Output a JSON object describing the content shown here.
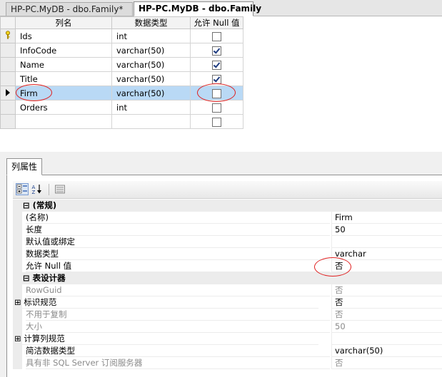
{
  "tabs": [
    {
      "label": "HP-PC.MyDB - dbo.Family*"
    },
    {
      "label": "HP-PC.MyDB - dbo.Family"
    }
  ],
  "grid": {
    "headers": {
      "name": "列名",
      "type": "数据类型",
      "nullable": "允许 Null 值"
    },
    "rows": [
      {
        "name": "Ids",
        "type": "int",
        "nullable": false,
        "key": true
      },
      {
        "name": "InfoCode",
        "type": "varchar(50)",
        "nullable": true
      },
      {
        "name": "Name",
        "type": "varchar(50)",
        "nullable": true
      },
      {
        "name": "Title",
        "type": "varchar(50)",
        "nullable": true
      },
      {
        "name": "Firm",
        "type": "varchar(50)",
        "nullable": false,
        "selected": true
      },
      {
        "name": "Orders",
        "type": "int",
        "nullable": false
      },
      {
        "name": "",
        "type": "",
        "nullable": false
      }
    ]
  },
  "properties": {
    "tab_label": "列属性",
    "rows": [
      {
        "kind": "cat",
        "expander": "⊟",
        "name": "(常规)",
        "value": ""
      },
      {
        "kind": "item",
        "name": "(名称)",
        "value": "Firm"
      },
      {
        "kind": "item",
        "name": "长度",
        "value": "50"
      },
      {
        "kind": "item",
        "name": "默认值或绑定",
        "value": ""
      },
      {
        "kind": "item",
        "name": "数据类型",
        "value": "varchar"
      },
      {
        "kind": "item",
        "name": "允许 Null 值",
        "value": "否"
      },
      {
        "kind": "cat",
        "expander": "⊟",
        "name": "表设计器",
        "value": ""
      },
      {
        "kind": "gray",
        "name": "RowGuid",
        "value": "否"
      },
      {
        "kind": "exp",
        "expander": "⊞",
        "name": "标识规范",
        "value": "否"
      },
      {
        "kind": "gray",
        "name": "不用于复制",
        "value": "否"
      },
      {
        "kind": "gray",
        "name": "大小",
        "value": "50"
      },
      {
        "kind": "exp",
        "expander": "⊞",
        "name": "计算列规范",
        "value": ""
      },
      {
        "kind": "item",
        "name": "简洁数据类型",
        "value": "varchar(50)"
      },
      {
        "kind": "gray",
        "name": "具有非 SQL Server 订阅服务器",
        "value": "否"
      }
    ]
  },
  "colors": {
    "highlight": "#b9d9f5",
    "annotation": "#e02020"
  }
}
